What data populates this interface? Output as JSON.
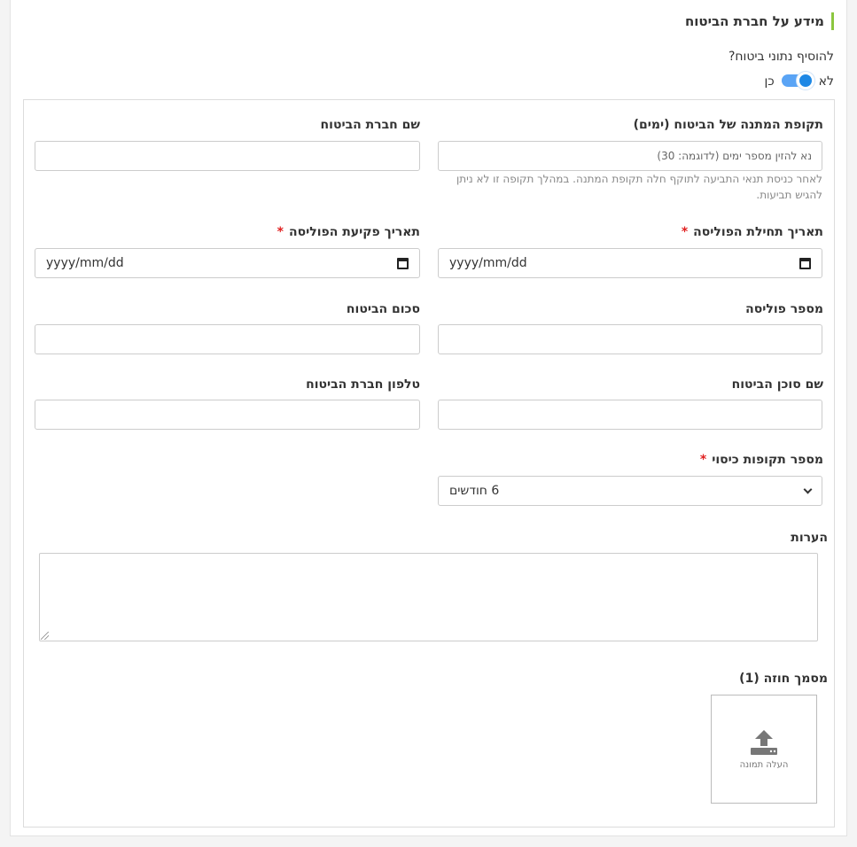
{
  "section": {
    "title": "מידע על חברת הביטוח",
    "question": "להוסיף נתוני ביטוח?",
    "toggle_no": "לא",
    "toggle_yes": "כן"
  },
  "fields": {
    "grace_period": {
      "label": "תקופת המתנה של הביטוח (ימים)",
      "placeholder": "נא להזין מספר ימים (לדוגמה: 30)",
      "hint": "לאחר כניסת תנאי התביעה לתוקף חלה תקופת המתנה. במהלך תקופה זו לא ניתן להגיש תביעות."
    },
    "company_name": {
      "label": "שם חברת הביטוח",
      "value": ""
    },
    "policy_start": {
      "label": "תאריך תחילת הפוליסה",
      "required": "*",
      "value": "yyyy/mm/dd"
    },
    "policy_end": {
      "label": "תאריך פקיעת הפוליסה",
      "required": "*",
      "value": "yyyy/mm/dd"
    },
    "policy_number": {
      "label": "מספר פוליסה",
      "value": ""
    },
    "insurance_amount": {
      "label": "סכום הביטוח",
      "value": ""
    },
    "agent_name": {
      "label": "שם סוכן הביטוח",
      "value": ""
    },
    "company_phone": {
      "label": "טלפון חברת הביטוח",
      "value": ""
    },
    "coverage_periods": {
      "label": "מספר תקופות כיסוי",
      "required": "*",
      "selected": "6 חודשים"
    },
    "notes": {
      "label": "הערות",
      "value": ""
    },
    "contract": {
      "label": "מסמך חוזה (1)",
      "upload_caption": "העלה תמונה"
    }
  },
  "colors": {
    "accent_green": "#8cc63f",
    "toggle_blue": "#1e88e5",
    "required_red": "#e02020"
  },
  "icons": {
    "upload": "upload-icon",
    "calendar": "calendar-icon",
    "dropdown": "chevron-down-icon"
  }
}
